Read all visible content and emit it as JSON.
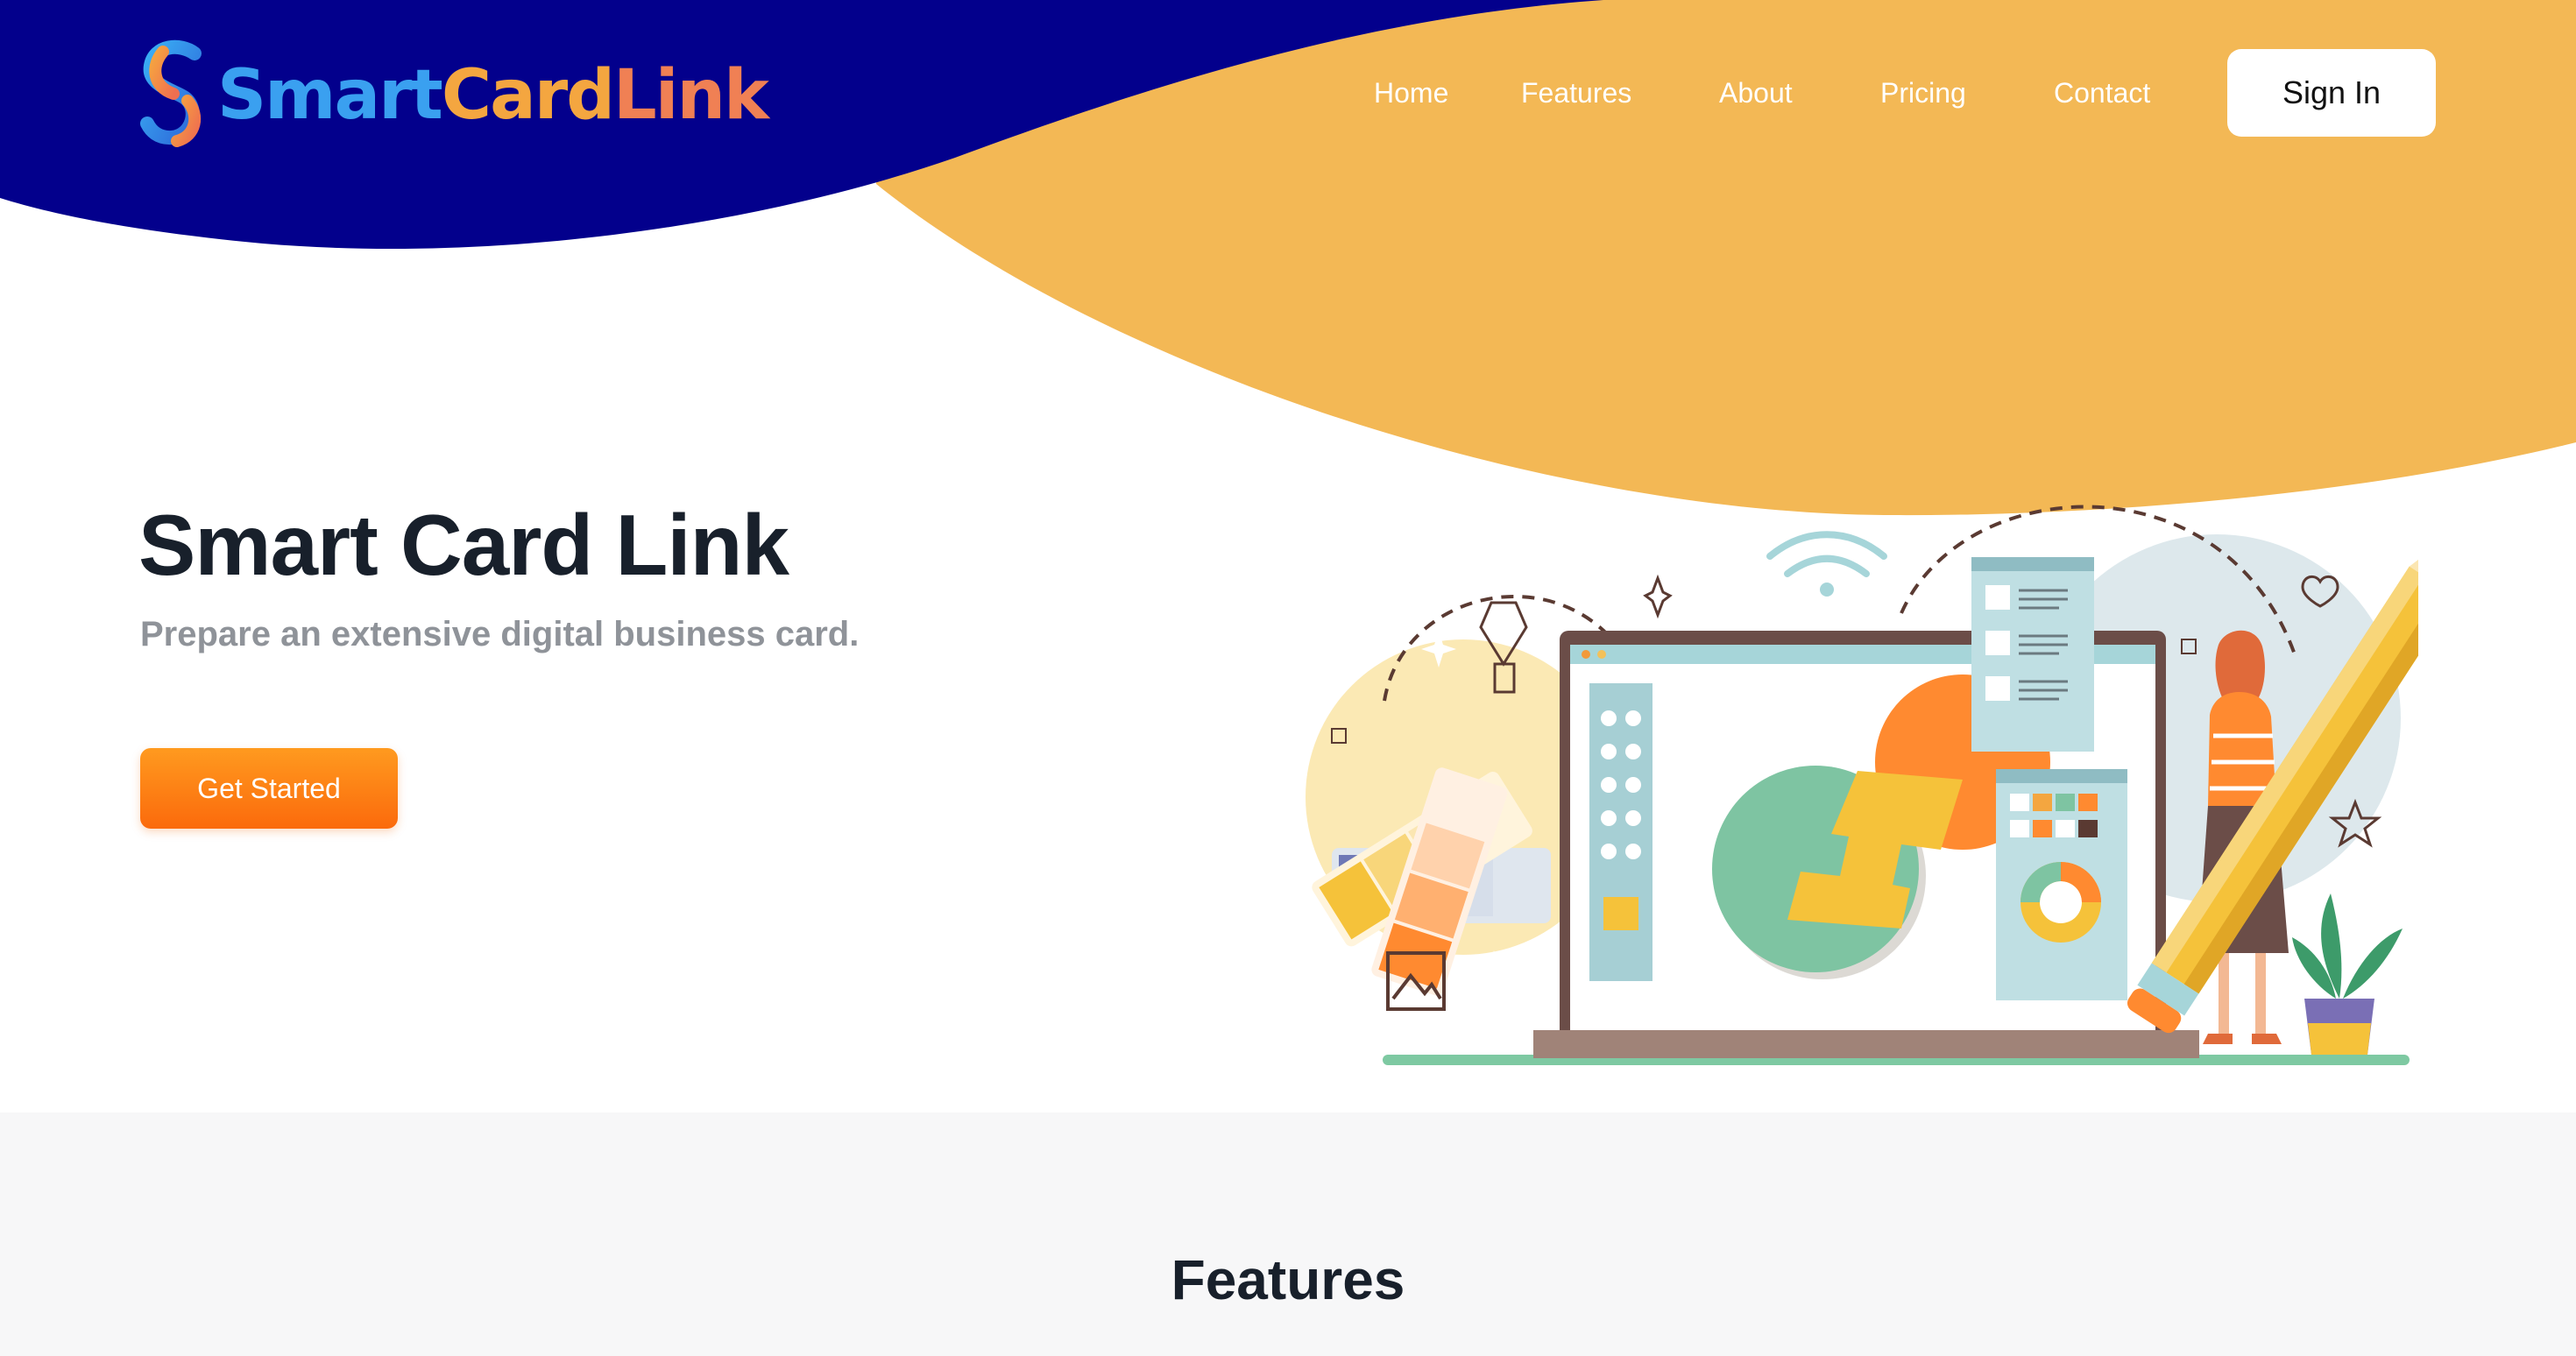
{
  "brand": {
    "name_part1": "Smart",
    "name_part2": "Card",
    "name_part3": "Link",
    "logo_icon": "s-link-logo-icon"
  },
  "nav": {
    "items": [
      {
        "label": "Home"
      },
      {
        "label": "Features"
      },
      {
        "label": "About"
      },
      {
        "label": "Pricing"
      },
      {
        "label": "Contact"
      }
    ],
    "signin_label": "Sign In"
  },
  "hero": {
    "title": "Smart Card Link",
    "subtitle": "Prepare an extensive digital business card.",
    "cta_label": "Get Started",
    "illustration": "designer-with-laptop-illustration"
  },
  "features": {
    "title": "Features"
  },
  "colors": {
    "navy": "#03008c",
    "orange_blob": "#f3b855",
    "cta_orange": "#fb7a12",
    "text_dark": "#18202b",
    "text_gray": "#8f9399",
    "section_gray": "#f7f7f8"
  }
}
